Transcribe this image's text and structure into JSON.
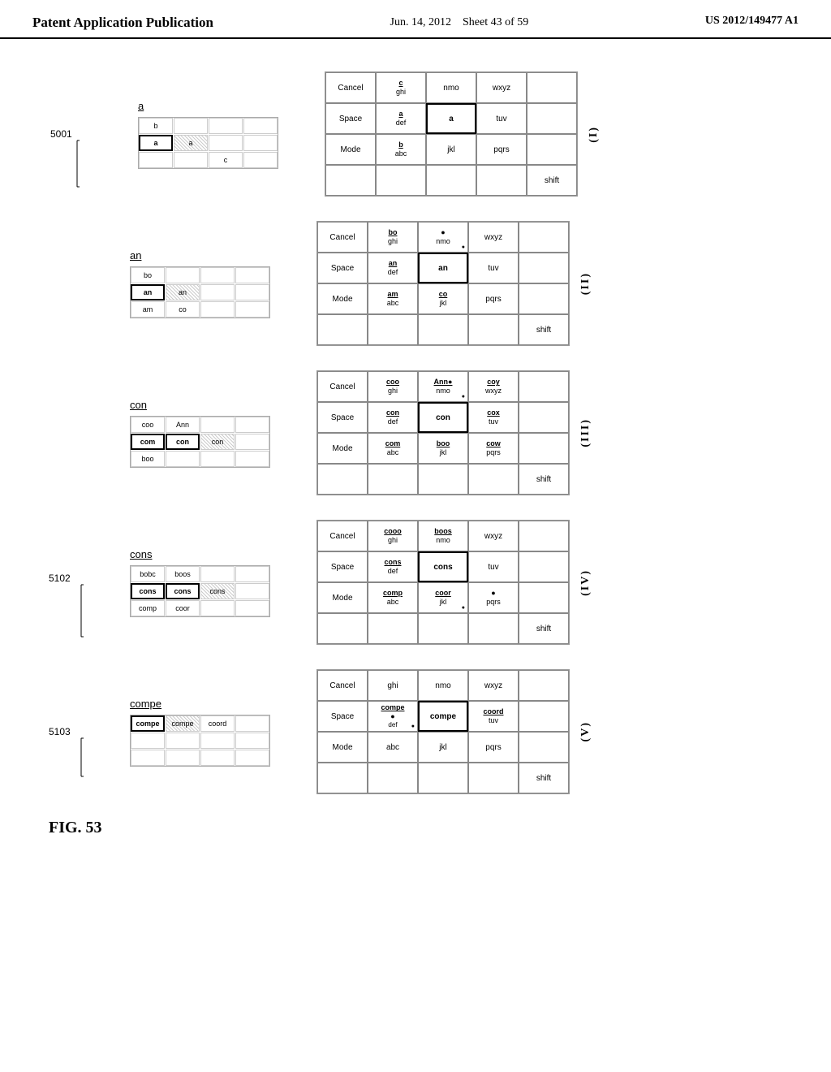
{
  "header": {
    "left": "Patent Application Publication",
    "center_line1": "Jun. 14, 2012",
    "center_line2": "Sheet 43 of 59",
    "right": "US 2012/149477 A1"
  },
  "fig_label": "FIG. 53",
  "row_5001_label": "5001",
  "row_5102_label": "5102",
  "row_5103_label": "5103",
  "rows": [
    {
      "id": "I",
      "input_text": "a",
      "suggestions": [
        [
          "b",
          "",
          "",
          ""
        ],
        [
          "a",
          "a",
          "",
          ""
        ],
        [
          "",
          "",
          "c",
          ""
        ]
      ],
      "highlight_suggestion": null,
      "keys": [
        [
          "Mode",
          "b\nabc",
          "",
          "jkl",
          "pqrs"
        ],
        [
          "Space",
          "a\ndef",
          "a",
          "tuv",
          ""
        ],
        [
          "Cancel",
          "c\nghi",
          "",
          "nmo",
          "wxyz"
        ],
        [
          "",
          "",
          "",
          "",
          "shift"
        ]
      ]
    },
    {
      "id": "II",
      "input_text": "an",
      "suggestions": [
        [
          "bo",
          "",
          "",
          ""
        ],
        [
          "an",
          "an",
          "",
          ""
        ],
        [
          "am",
          "co",
          "",
          ""
        ]
      ],
      "keys": [
        [
          "Mode",
          "am\nabc",
          "co\njkl",
          "",
          "pqrs"
        ],
        [
          "Space",
          "an\ndef",
          "an",
          "tuv",
          ""
        ],
        [
          "Cancel",
          "bo\nghi",
          "●\nnmo",
          "wxyz",
          ""
        ],
        [
          "",
          "",
          "",
          "",
          "shift"
        ]
      ]
    },
    {
      "id": "III",
      "input_text": "con",
      "suggestions": [
        [
          "coo",
          "Ann",
          "",
          ""
        ],
        [
          "com",
          "con",
          "con",
          ""
        ],
        [
          "boo",
          "",
          "",
          ""
        ]
      ],
      "keys": [
        [
          "Mode",
          "com\nabc",
          "boo\njkl",
          "cow\npqrs",
          ""
        ],
        [
          "Space",
          "con\ndef",
          "con",
          "cox\ntuv",
          ""
        ],
        [
          "Cancel",
          "coo\nghi",
          "Ann●\nnmo",
          "coy\nwxyz",
          ""
        ],
        [
          "",
          "",
          "",
          "",
          "shift"
        ]
      ]
    },
    {
      "id": "IV",
      "input_text": "cons",
      "suggestions": [
        [
          "bobc",
          "boos",
          "",
          ""
        ],
        [
          "cons",
          "cons",
          "cons",
          ""
        ],
        [
          "comp",
          "coor",
          "",
          ""
        ]
      ],
      "keys": [
        [
          "Mode",
          "comp\nabc",
          "coor\njkl",
          "●\npqrs",
          ""
        ],
        [
          "Space",
          "cons\ndef",
          "cons",
          "tuv",
          ""
        ],
        [
          "Cancel",
          "cooo\nghi",
          "boos\nnmo",
          "wxyz",
          ""
        ],
        [
          "",
          "",
          "",
          "",
          "shift"
        ]
      ]
    },
    {
      "id": "V",
      "input_text": "compe",
      "suggestions": [
        [
          "compe",
          "compe",
          "coord",
          ""
        ],
        [
          "",
          "",
          "",
          ""
        ],
        [
          "",
          "",
          "",
          ""
        ]
      ],
      "keys": [
        [
          "Mode",
          "abc",
          "jkl",
          "pqrs",
          ""
        ],
        [
          "Space",
          "compe\n●\ndef",
          "compe",
          "coord\ntuv",
          ""
        ],
        [
          "Cancel",
          "ghi",
          "nmo",
          "wxyz",
          ""
        ],
        [
          "",
          "",
          "",
          "",
          "shift"
        ]
      ]
    }
  ]
}
